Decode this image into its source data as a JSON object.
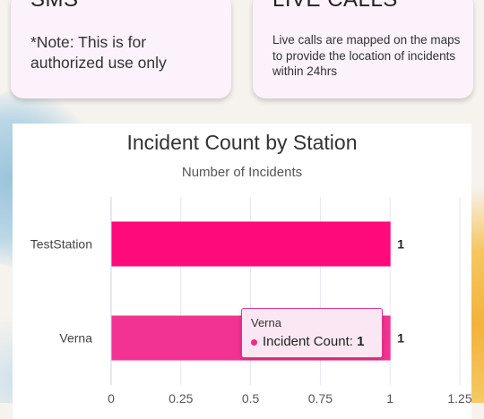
{
  "cards": [
    {
      "title": "SMS",
      "body": "*Note: This is for authorized use only"
    },
    {
      "title": "LIVE CALLS",
      "body": "Live calls are mapped on the maps to provide the location of incidents within 24hrs"
    }
  ],
  "colors": {
    "bar": "#ff0a7a",
    "bar_hover": "#f33393",
    "tooltip_border": "#e0368f",
    "card_bg": "#fbf2fb"
  },
  "chart_data": {
    "type": "bar",
    "orientation": "horizontal",
    "title": "Incident Count by Station",
    "subtitle": "Number of Incidents",
    "categories": [
      "TestStation",
      "Verna"
    ],
    "series": [
      {
        "name": "Incident Count",
        "values": [
          1,
          1
        ]
      }
    ],
    "xlim": [
      0,
      1.25
    ],
    "ticks": [
      "0",
      "0.25",
      "0.5",
      "0.75",
      "1",
      "1.25"
    ],
    "data_labels": [
      "1",
      "1"
    ],
    "grid": true
  },
  "tooltip": {
    "category": "Verna",
    "series": "Incident Count",
    "value": "1"
  }
}
